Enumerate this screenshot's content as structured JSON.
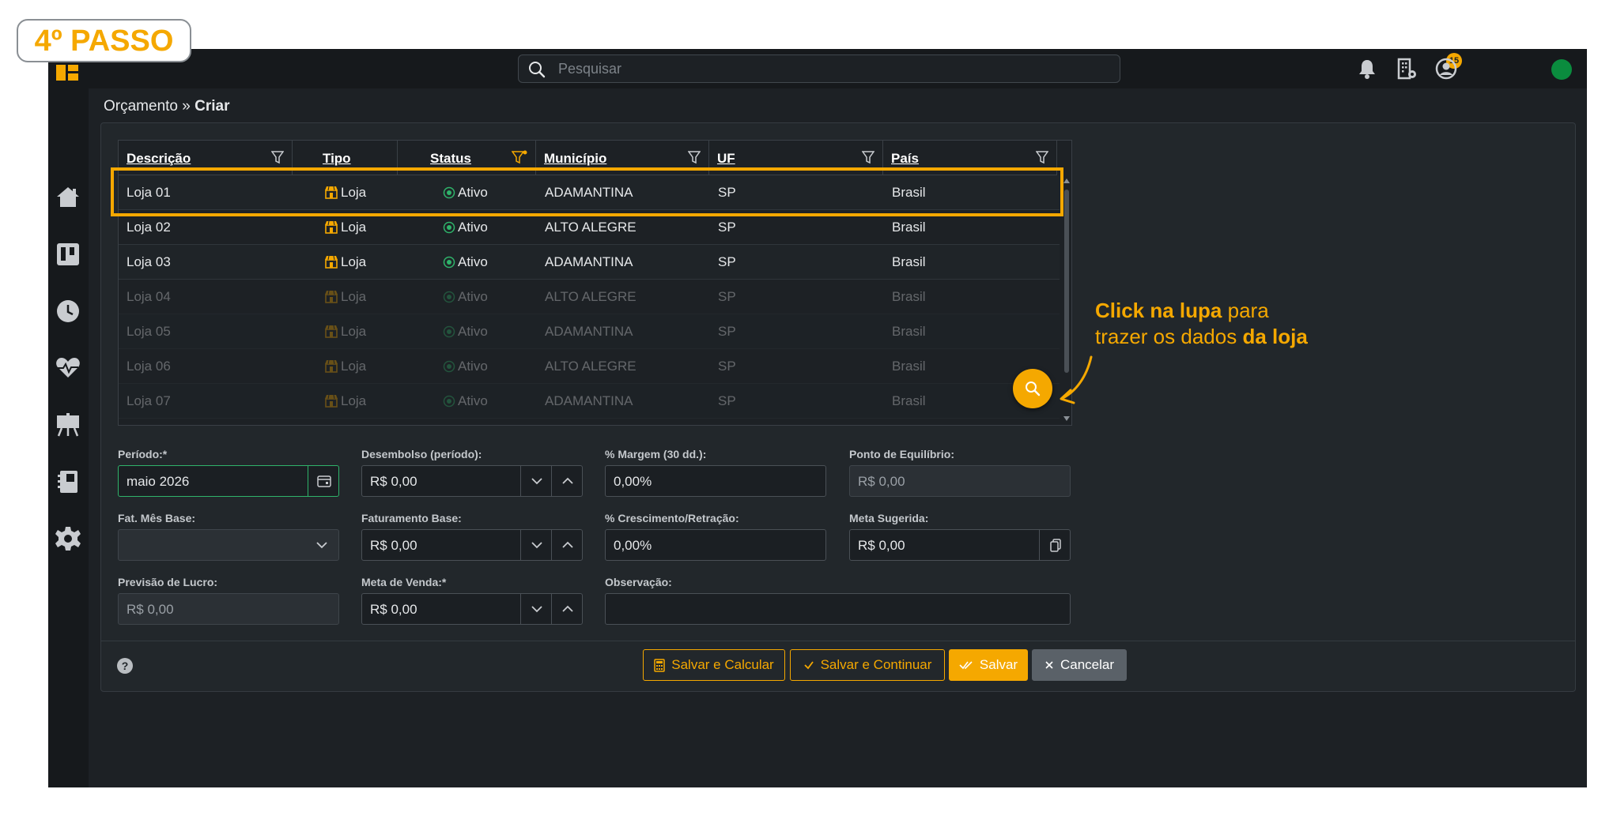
{
  "tutorial": {
    "step_label": "4º PASSO",
    "callout_part1": "Click na lupa",
    "callout_part2": " para",
    "callout_part3": "trazer os dados ",
    "callout_part4": "da loja"
  },
  "topbar": {
    "search_placeholder": "Pesquisar",
    "notifications_count": "15"
  },
  "breadcrumb": {
    "parent": "Orçamento",
    "separator": " » ",
    "current": "Criar"
  },
  "grid": {
    "columns": [
      "Descrição",
      "Tipo",
      "Status",
      "Município",
      "UF",
      "País"
    ],
    "rows": [
      {
        "descricao": "Loja 01",
        "tipo": "Loja",
        "status": "Ativo",
        "municipio": "ADAMANTINA",
        "uf": "SP",
        "pais": "Brasil"
      },
      {
        "descricao": "Loja 02",
        "tipo": "Loja",
        "status": "Ativo",
        "municipio": "ALTO ALEGRE",
        "uf": "SP",
        "pais": "Brasil"
      },
      {
        "descricao": "Loja 03",
        "tipo": "Loja",
        "status": "Ativo",
        "municipio": "ADAMANTINA",
        "uf": "SP",
        "pais": "Brasil"
      },
      {
        "descricao": "Loja 04",
        "tipo": "Loja",
        "status": "Ativo",
        "municipio": "ALTO ALEGRE",
        "uf": "SP",
        "pais": "Brasil"
      },
      {
        "descricao": "Loja 05",
        "tipo": "Loja",
        "status": "Ativo",
        "municipio": "ADAMANTINA",
        "uf": "SP",
        "pais": "Brasil"
      },
      {
        "descricao": "Loja 06",
        "tipo": "Loja",
        "status": "Ativo",
        "municipio": "ALTO ALEGRE",
        "uf": "SP",
        "pais": "Brasil"
      },
      {
        "descricao": "Loja 07",
        "tipo": "Loja",
        "status": "Ativo",
        "municipio": "ADAMANTINA",
        "uf": "SP",
        "pais": "Brasil"
      }
    ]
  },
  "form": {
    "periodo": {
      "label": "Período:*",
      "value": "maio 2026"
    },
    "desembolso": {
      "label": "Desembolso (período):",
      "value": "R$ 0,00"
    },
    "margem": {
      "label": "% Margem (30 dd.):",
      "value": "0,00%"
    },
    "ponto_equilibrio": {
      "label": "Ponto de Equilíbrio:",
      "value": "R$ 0,00"
    },
    "fat_mes_base": {
      "label": "Fat. Mês Base:",
      "value": ""
    },
    "faturamento_base": {
      "label": "Faturamento Base:",
      "value": "R$ 0,00"
    },
    "crescimento": {
      "label": "% Crescimento/Retração:",
      "value": "0,00%"
    },
    "meta_sugerida": {
      "label": "Meta Sugerida:",
      "value": "R$ 0,00"
    },
    "previsao_lucro": {
      "label": "Previsão de Lucro:",
      "value": "R$ 0,00"
    },
    "meta_venda": {
      "label": "Meta de Venda:*",
      "value": "R$ 0,00"
    },
    "observacao": {
      "label": "Observação:",
      "value": ""
    }
  },
  "footer": {
    "help": "?",
    "btn_salvar_calcular": "Salvar e Calcular",
    "btn_salvar_continuar": "Salvar e Continuar",
    "btn_salvar": "Salvar",
    "btn_cancelar": "Cancelar"
  },
  "colors": {
    "accent": "#f5a800",
    "bg": "#1d2125",
    "active": "#2fb36a"
  }
}
